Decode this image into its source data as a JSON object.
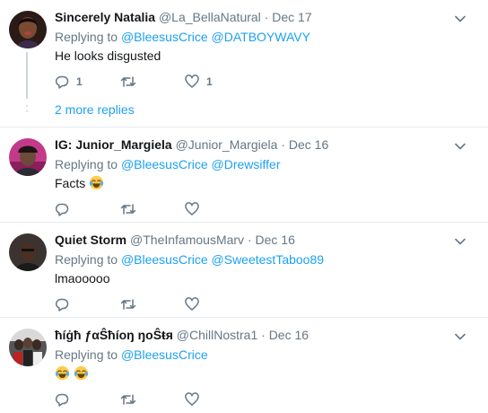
{
  "icons": {
    "reply": "reply-icon",
    "retweet": "retweet-icon",
    "like": "heart-icon",
    "caret": "chevron-down-icon",
    "emoji": "face-with-tears-of-joy-emoji"
  },
  "colors": {
    "link": "#1da1f2",
    "muted": "#657786",
    "text": "#14171a",
    "divider": "#e6ecf0"
  },
  "tweets": [
    {
      "name": "Sincerely Natalia",
      "handle": "@La_BellaNatural",
      "sep": "·",
      "date": "Dec 17",
      "replying_label": "Replying to",
      "mentions": [
        "@BleesusCrice",
        "@DATBOYWAVY"
      ],
      "text": "He looks disgusted",
      "reply_count": "1",
      "retweet_count": "",
      "like_count": "1"
    },
    {
      "name": "IG: Junior_Margiela",
      "handle": "@Junior_Margiela",
      "sep": "·",
      "date": "Dec 16",
      "replying_label": "Replying to",
      "mentions": [
        "@BleesusCrice",
        "@Drewsiffer"
      ],
      "text": "Facts",
      "reply_count": "",
      "retweet_count": "",
      "like_count": ""
    },
    {
      "name": "Quiet Storm",
      "handle": "@TheInfamousMarv",
      "sep": "·",
      "date": "Dec 16",
      "replying_label": "Replying to",
      "mentions": [
        "@BleesusCrice",
        "@SweetestTaboo89"
      ],
      "text": "lmaooooo",
      "reply_count": "",
      "retweet_count": "",
      "like_count": ""
    },
    {
      "name": "ħíġħ ƒαŜħíοŋ ŋοŜŧя",
      "handle": "@ChillNostra1",
      "sep": "·",
      "date": "Dec 16",
      "replying_label": "Replying to",
      "mentions": [
        "@BleesusCrice"
      ],
      "text": "",
      "reply_count": "",
      "retweet_count": "",
      "like_count": ""
    }
  ],
  "more_replies": "2 more replies"
}
